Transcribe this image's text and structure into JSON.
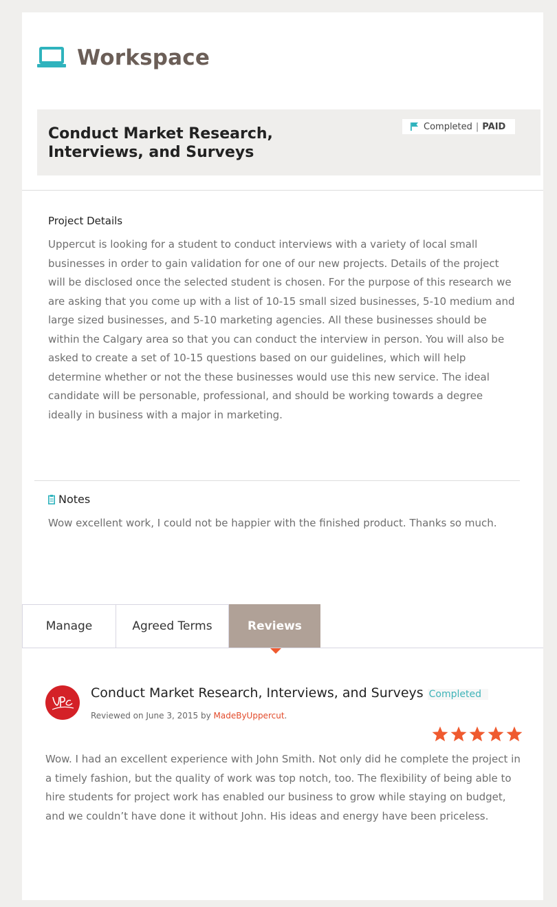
{
  "workspace": {
    "title": "Workspace",
    "icon": "laptop-icon"
  },
  "project": {
    "title": "Conduct Market Research, Interviews, and Surveys",
    "status": "Completed",
    "status_separator": "|",
    "payment": "PAID",
    "status_icon": "flag-icon"
  },
  "details": {
    "heading": "Project Details",
    "body": "Uppercut is looking for a student to conduct interviews with a variety of local small businesses in order to gain validation for one of our new projects. Details of the project will be disclosed once the selected student is chosen. For the purpose of this research we are asking that you come up with a list of 10-15 small sized businesses, 5-10 medium and large sized businesses, and 5-10 marketing agencies. All these businesses should be within the Calgary area so that you can conduct the interview in person. You will also be asked to create a set of 10-15 questions based on our guidelines, which will help determine whether or not the these businesses would use this new service. The ideal candidate will be personable, professional, and should be working towards a degree ideally in business with a major in marketing."
  },
  "notes": {
    "heading": "Notes",
    "icon": "clipboard-icon",
    "body": "Wow excellent work, I could not be happier with the finished product. Thanks so much."
  },
  "tabs": [
    {
      "label": "Manage",
      "active": false
    },
    {
      "label": "Agreed Terms",
      "active": false
    },
    {
      "label": "Reviews",
      "active": true
    }
  ],
  "review": {
    "title": "Conduct Market Research, Interviews, and Surveys",
    "status": "Completed",
    "meta_prefix": "Reviewed on June 3, 2015 by ",
    "author": "MadeByUppercut",
    "meta_suffix": ".",
    "rating": 5,
    "rating_max": 5,
    "body": "Wow. I had an excellent experience with John Smith. Not only did he complete the project in a timely fashion, but the quality of work was top notch, too. The flexibility of being able to hire students for project work has enabled our business to grow while staying on budget, and we couldn’t have done it without John. His ideas and energy have been priceless."
  },
  "colors": {
    "accent_teal": "#3fb3b8",
    "tab_active": "#b0a197",
    "star": "#ef5a2f",
    "author": "#e24a2a",
    "avatar": "#d42127"
  }
}
